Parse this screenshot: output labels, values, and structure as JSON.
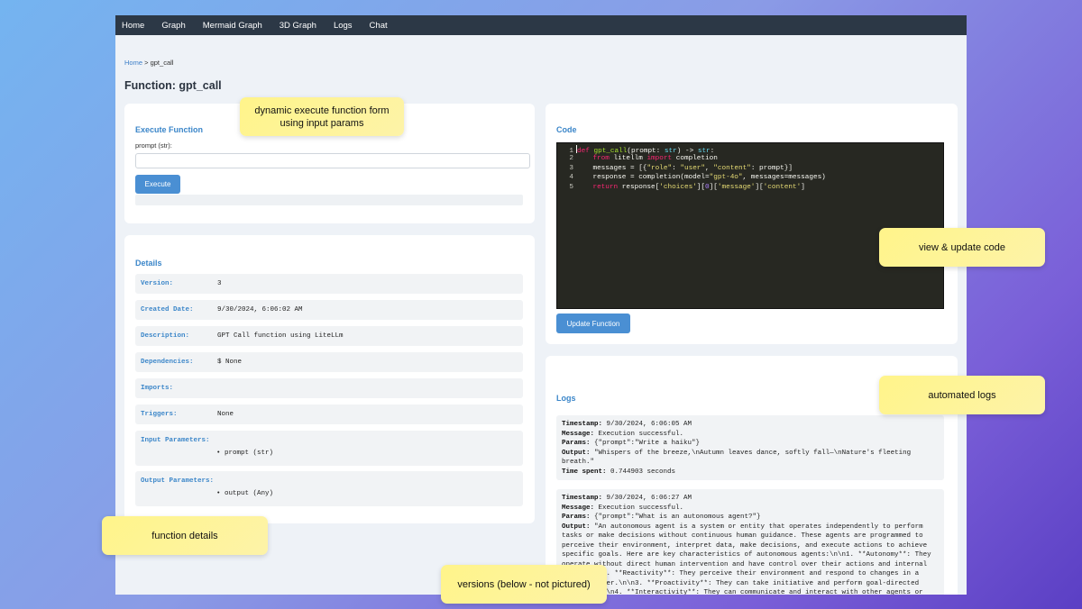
{
  "nav": [
    "Home",
    "Graph",
    "Mermaid Graph",
    "3D Graph",
    "Logs",
    "Chat"
  ],
  "breadcrumb": {
    "home": "Home",
    "sep": ">",
    "current": "gpt_call"
  },
  "page_title": "Function: gpt_call",
  "execute": {
    "title": "Execute Function",
    "param_label": "prompt (str):",
    "param_value": "",
    "button": "Execute"
  },
  "details": {
    "title": "Details",
    "rows": [
      {
        "key": "Version:",
        "value": "3"
      },
      {
        "key": "Created Date:",
        "value": "9/30/2024, 6:06:02 AM"
      },
      {
        "key": "Description:",
        "value": "GPT Call function using LiteLLm"
      },
      {
        "key": "Dependencies:",
        "value": "$ None"
      },
      {
        "key": "Imports:",
        "value": ""
      },
      {
        "key": "Triggers:",
        "value": "None"
      },
      {
        "key": "Input Parameters:",
        "value": "• prompt (str)"
      },
      {
        "key": "Output Parameters:",
        "value": "• output (Any)"
      }
    ]
  },
  "code": {
    "title": "Code",
    "line_numbers": [
      "1",
      "2",
      "3",
      "4",
      "5"
    ],
    "button": "Update Function"
  },
  "logs": {
    "title": "Logs",
    "labels": {
      "timestamp": "Timestamp:",
      "message": "Message:",
      "params": "Params:",
      "output": "Output:",
      "time_spent": "Time spent:"
    },
    "entries": [
      {
        "timestamp": "9/30/2024, 6:06:05 AM",
        "message": "Execution successful.",
        "params": "{\"prompt\":\"Write a haiku\"}",
        "output": "\"Whispers of the breeze,\\nAutumn leaves dance, softly fall—\\nNature's fleeting breath.\"",
        "time_spent": "0.744903 seconds"
      },
      {
        "timestamp": "9/30/2024, 6:06:27 AM",
        "message": "Execution successful.",
        "params": "{\"prompt\":\"What is an autonomous agent?\"}",
        "output": "\"An autonomous agent is a system or entity that operates independently to perform tasks or make decisions without continuous human guidance. These agents are programmed to perceive their environment, interpret data, make decisions, and execute actions to achieve specific goals. Here are key characteristics of autonomous agents:\\n\\n1. **Autonomy**: They operate without direct human intervention and have control over their actions and internal state.\\n\\n2. **Reactivity**: They perceive their environment and respond to changes in a timely manner.\\n\\n3. **Proactivity**: They can take initiative and perform goal-directed behavior.\\n\\n4. **Interactivity**: They can communicate and interact with other agents or humans to achieve their objectives.\\n\\nAutonomous agents are utilized in various domains, including robotics, artificial intelligence (AI), virtual assistants, and more. Examples"
      }
    ]
  },
  "callouts": {
    "form": "dynamic execute function form using input params",
    "code": "view & update code",
    "logs": "automated logs",
    "details": "function details",
    "versions": "versions (below - not pictured)"
  }
}
